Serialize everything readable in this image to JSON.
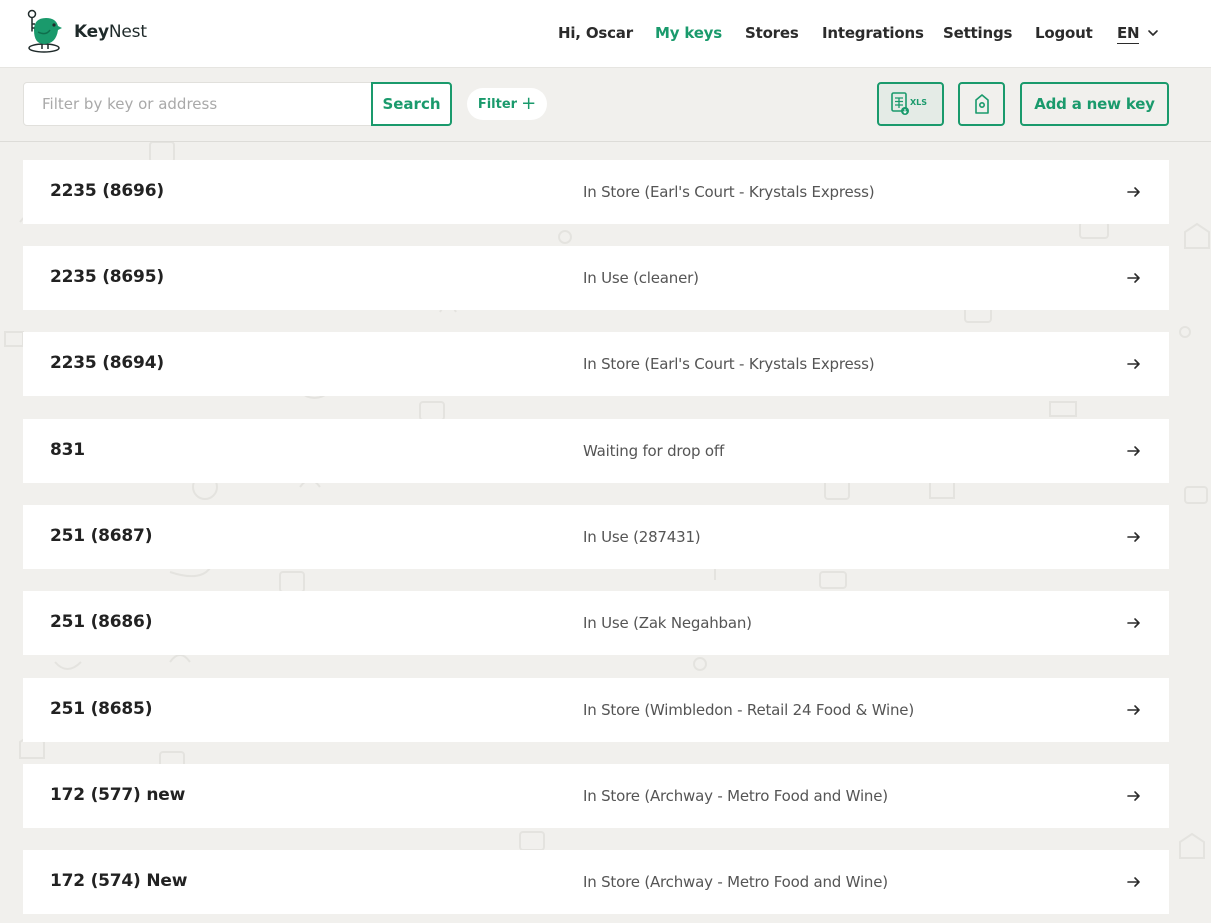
{
  "brand": {
    "name_bold": "Key",
    "name_regular": "Nest",
    "accent": "#1a9a6c"
  },
  "nav": {
    "greeting": "Hi, Oscar",
    "items": [
      {
        "label": "My keys",
        "active": true
      },
      {
        "label": "Stores",
        "active": false
      },
      {
        "label": "Integrations",
        "active": false
      },
      {
        "label": "Settings",
        "active": false
      },
      {
        "label": "Logout",
        "active": false
      }
    ],
    "language": "EN"
  },
  "toolbar": {
    "search_placeholder": "Filter by key or address",
    "search_value": "",
    "search_label": "Search",
    "filter_label": "Filter",
    "xls_label": "XLS",
    "add_label": "Add a new key"
  },
  "keys": [
    {
      "name": "2235 (8696)",
      "status": "In Store (Earl's Court - Krystals Express)"
    },
    {
      "name": "2235 (8695)",
      "status": "In Use (cleaner)"
    },
    {
      "name": "2235 (8694)",
      "status": "In Store (Earl's Court - Krystals Express)"
    },
    {
      "name": "831",
      "status": "Waiting for drop off"
    },
    {
      "name": "251 (8687)",
      "status": "In Use (287431)"
    },
    {
      "name": "251 (8686)",
      "status": "In Use (Zak Negahban)"
    },
    {
      "name": "251 (8685)",
      "status": "In Store (Wimbledon - Retail 24 Food & Wine)"
    },
    {
      "name": "172 (577) new",
      "status": "In Store (Archway - Metro Food and Wine)"
    },
    {
      "name": "172 (574) New",
      "status": "In Store (Archway - Metro Food and Wine)"
    }
  ]
}
